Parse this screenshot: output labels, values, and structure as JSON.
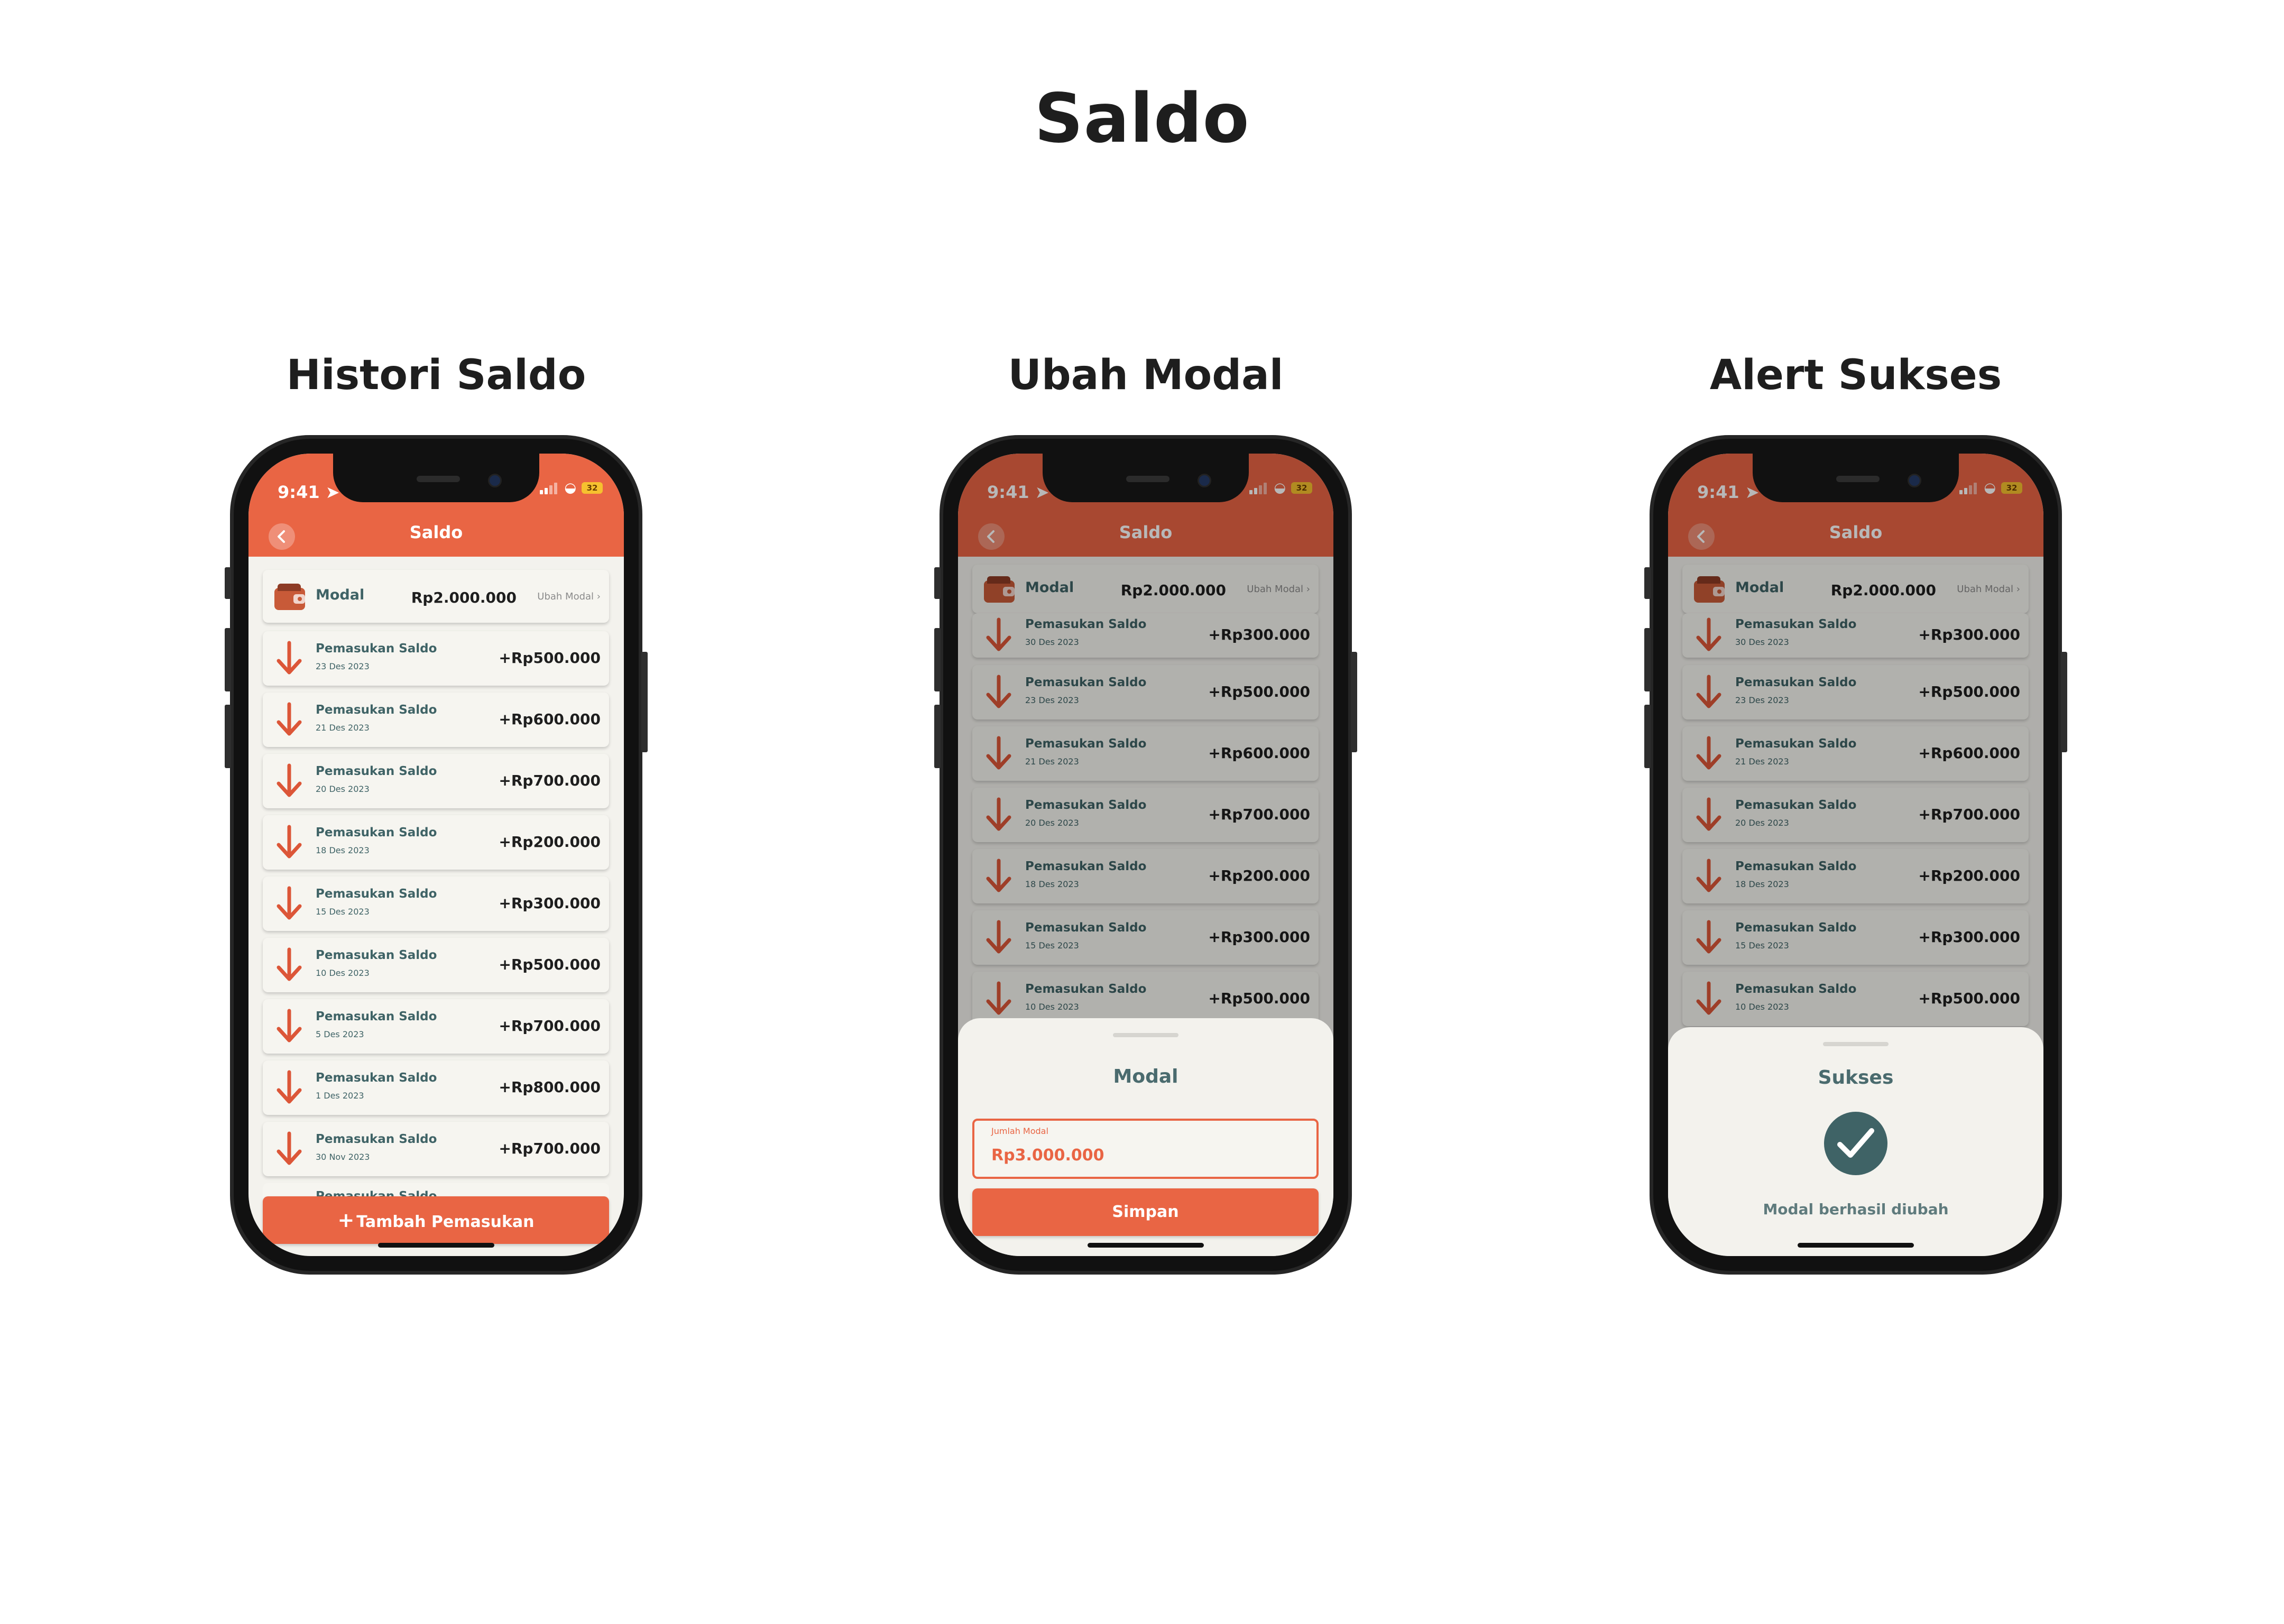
{
  "page": {
    "title": "Saldo"
  },
  "colors": {
    "accent": "#e96544",
    "teal": "#3f6366",
    "background": "#f3f2ed",
    "battery": "#f6c12f"
  },
  "icons": {
    "back": "chevron-left-icon",
    "wallet": "wallet-icon",
    "income": "arrow-down-icon",
    "add": "plus-icon",
    "success": "check-circle-icon",
    "location": "location-arrow-icon",
    "wifi": "wifi-icon"
  },
  "status_bar": {
    "time": "9:41",
    "battery": "32"
  },
  "screens": [
    {
      "label": "Histori Saldo",
      "header": {
        "title": "Saldo"
      },
      "modal": {
        "label": "Modal",
        "amount": "Rp2.000.000",
        "action": "Ubah Modal"
      },
      "transactions": [
        {
          "title": "Pemasukan Saldo",
          "date": "23 Des 2023",
          "amount": "+Rp500.000"
        },
        {
          "title": "Pemasukan Saldo",
          "date": "21 Des 2023",
          "amount": "+Rp600.000"
        },
        {
          "title": "Pemasukan Saldo",
          "date": "20 Des 2023",
          "amount": "+Rp700.000"
        },
        {
          "title": "Pemasukan Saldo",
          "date": "18 Des 2023",
          "amount": "+Rp200.000"
        },
        {
          "title": "Pemasukan Saldo",
          "date": "15 Des 2023",
          "amount": "+Rp300.000"
        },
        {
          "title": "Pemasukan Saldo",
          "date": "10 Des 2023",
          "amount": "+Rp500.000"
        },
        {
          "title": "Pemasukan Saldo",
          "date": "5 Des 2023",
          "amount": "+Rp700.000"
        },
        {
          "title": "Pemasukan Saldo",
          "date": "1 Des 2023",
          "amount": "+Rp800.000"
        },
        {
          "title": "Pemasukan Saldo",
          "date": "30 Nov 2023",
          "amount": "+Rp700.000"
        }
      ],
      "partial_row_title": "Pemasukan Saldo",
      "add_button": "Tambah Pemasukan"
    },
    {
      "label": "Ubah Modal",
      "header": {
        "title": "Saldo"
      },
      "modal": {
        "label": "Modal",
        "amount": "Rp2.000.000",
        "action": "Ubah Modal"
      },
      "transactions": [
        {
          "title": "Pemasukan Saldo",
          "date": "30 Des 2023",
          "amount": "+Rp300.000"
        },
        {
          "title": "Pemasukan Saldo",
          "date": "23 Des 2023",
          "amount": "+Rp500.000"
        },
        {
          "title": "Pemasukan Saldo",
          "date": "21 Des 2023",
          "amount": "+Rp600.000"
        },
        {
          "title": "Pemasukan Saldo",
          "date": "20 Des 2023",
          "amount": "+Rp700.000"
        },
        {
          "title": "Pemasukan Saldo",
          "date": "18 Des 2023",
          "amount": "+Rp200.000"
        },
        {
          "title": "Pemasukan Saldo",
          "date": "15 Des 2023",
          "amount": "+Rp300.000"
        },
        {
          "title": "Pemasukan Saldo",
          "date": "10 Des 2023",
          "amount": "+Rp500.000"
        }
      ],
      "sheet": {
        "title": "Modal",
        "field_label": "Jumlah Modal",
        "field_value": "Rp3.000.000",
        "save_button": "Simpan"
      }
    },
    {
      "label": "Alert Sukses",
      "header": {
        "title": "Saldo"
      },
      "modal": {
        "label": "Modal",
        "amount": "Rp2.000.000",
        "action": "Ubah Modal"
      },
      "transactions": [
        {
          "title": "Pemasukan Saldo",
          "date": "30 Des 2023",
          "amount": "+Rp300.000"
        },
        {
          "title": "Pemasukan Saldo",
          "date": "23 Des 2023",
          "amount": "+Rp500.000"
        },
        {
          "title": "Pemasukan Saldo",
          "date": "21 Des 2023",
          "amount": "+Rp600.000"
        },
        {
          "title": "Pemasukan Saldo",
          "date": "20 Des 2023",
          "amount": "+Rp700.000"
        },
        {
          "title": "Pemasukan Saldo",
          "date": "18 Des 2023",
          "amount": "+Rp200.000"
        },
        {
          "title": "Pemasukan Saldo",
          "date": "15 Des 2023",
          "amount": "+Rp300.000"
        },
        {
          "title": "Pemasukan Saldo",
          "date": "10 Des 2023",
          "amount": "+Rp500.000"
        }
      ],
      "alert": {
        "title": "Sukses",
        "message": "Modal berhasil diubah"
      }
    }
  ]
}
